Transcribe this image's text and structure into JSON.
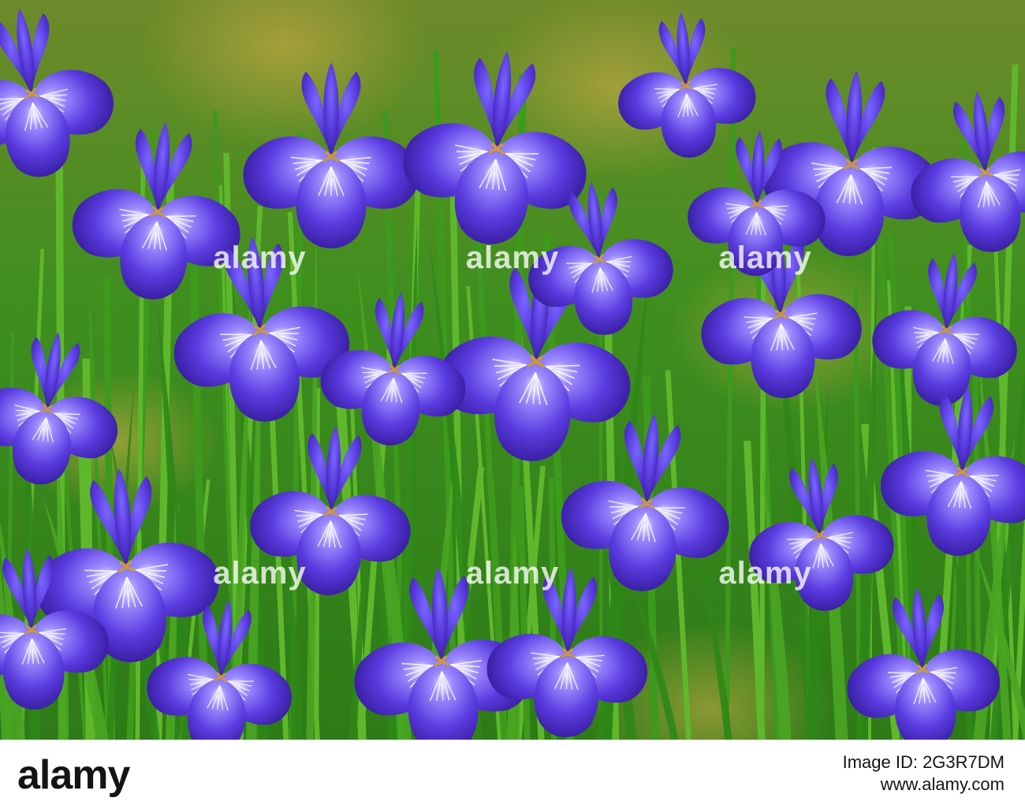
{
  "watermark": {
    "text": "alamy"
  },
  "footer": {
    "logo_text": "alamy",
    "image_id_line": "Image ID: 2G3R7DM",
    "url_line": "www.alamy.com"
  },
  "colors": {
    "iris_purple": "#5b3fd8",
    "iris_dark": "#3a1fa8",
    "leaf_green": "#3f9a1e",
    "accent_white": "#ffffff"
  }
}
